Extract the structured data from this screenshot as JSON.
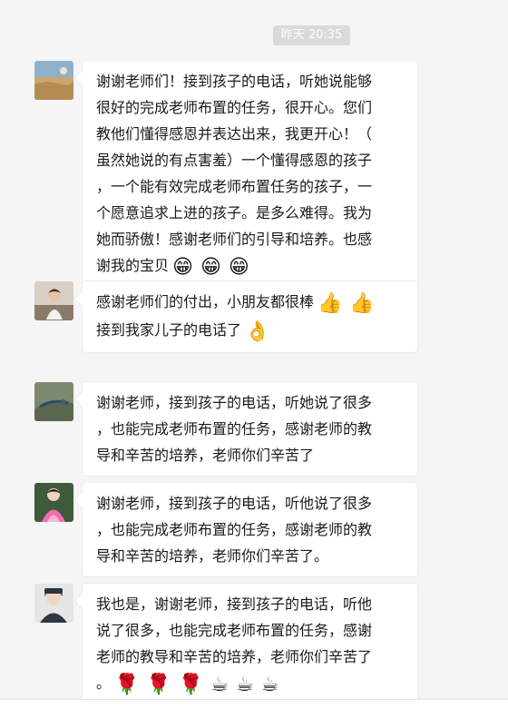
{
  "chat": {
    "timestamp": "昨天 20:35",
    "messages": [
      {
        "lines": [
          "谢谢老师们！接到孩子的电话，听她说能够",
          "很好的完成老师布置的任务，很开心。您们",
          "教他们懂得感恩并表达出来，我更开心！（",
          "虽然她说的有点害羞）一个懂得感恩的孩子",
          "，一个能有效完成老师布置任务的孩子，一",
          "个愿意追求上进的孩子。是多么难得。我为",
          "她而骄傲！感谢老师们的引导和培养。也感",
          "谢我的宝贝"
        ],
        "emojis": [
          "😁",
          "😁",
          "😁"
        ]
      },
      {
        "lines": [
          "感谢老师们的付出，小朋友都很棒",
          "接到我家儿子的电话了"
        ],
        "line1_emojis": [
          "👍",
          "👍"
        ],
        "line2_emojis": [
          "👌"
        ]
      },
      {
        "lines": [
          "谢谢老师，接到孩子的电话，听她说了很多",
          "，也能完成老师布置的任务，感谢老师的教",
          "导和辛苦的培养，老师你们辛苦了"
        ]
      },
      {
        "lines": [
          "谢谢老师，接到孩子的电话，听他说了很多",
          "，也能完成老师布置的任务，感谢老师的教",
          "导和辛苦的培养，老师你们辛苦了。"
        ]
      },
      {
        "lines": [
          "我也是，谢谢老师，接到孩子的电话，听他",
          "说了很多，也能完成老师布置的任务，感谢",
          "老师的教导和辛苦的培养，老师你们辛苦了",
          "。"
        ],
        "emojis": [
          "🌹",
          "🌹",
          "🌹",
          "☕",
          "☕",
          "☕"
        ]
      }
    ]
  }
}
